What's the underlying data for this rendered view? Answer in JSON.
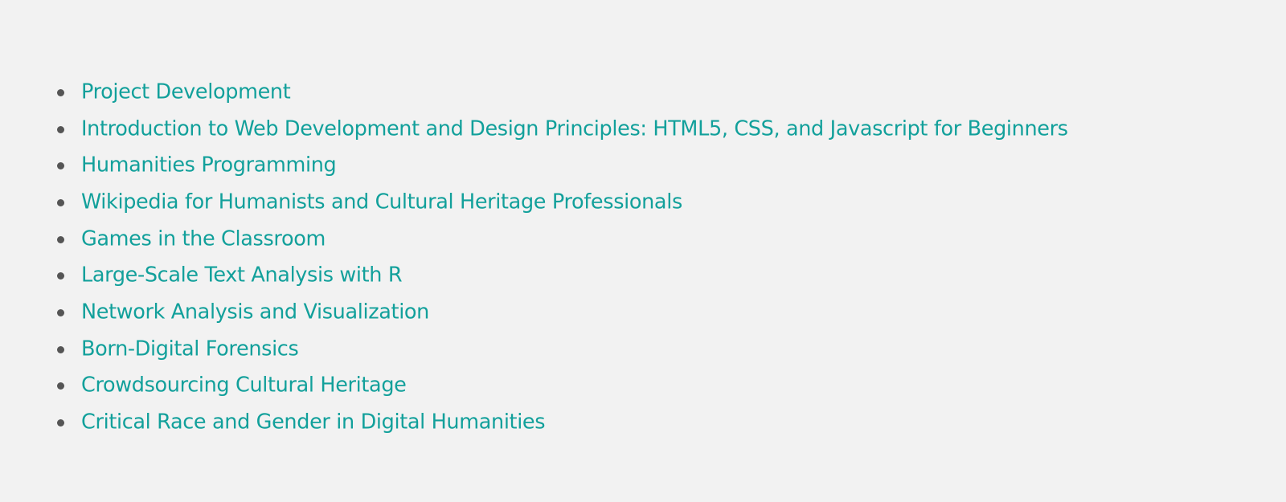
{
  "accent_color": "#12a09b",
  "bullet_color": "#555555",
  "background_color": "#f2f2f2",
  "courses": [
    {
      "label": "Project Development"
    },
    {
      "label": "Introduction to Web Development and Design Principles: HTML5, CSS, and Javascript for Beginners"
    },
    {
      "label": "Humanities Programming"
    },
    {
      "label": "Wikipedia for Humanists and Cultural Heritage Professionals"
    },
    {
      "label": "Games in the Classroom"
    },
    {
      "label": "Large-Scale Text Analysis with R"
    },
    {
      "label": "Network Analysis and Visualization"
    },
    {
      "label": "Born-Digital Forensics"
    },
    {
      "label": "Crowdsourcing Cultural Heritage"
    },
    {
      "label": "Critical Race and Gender in Digital Humanities"
    }
  ]
}
